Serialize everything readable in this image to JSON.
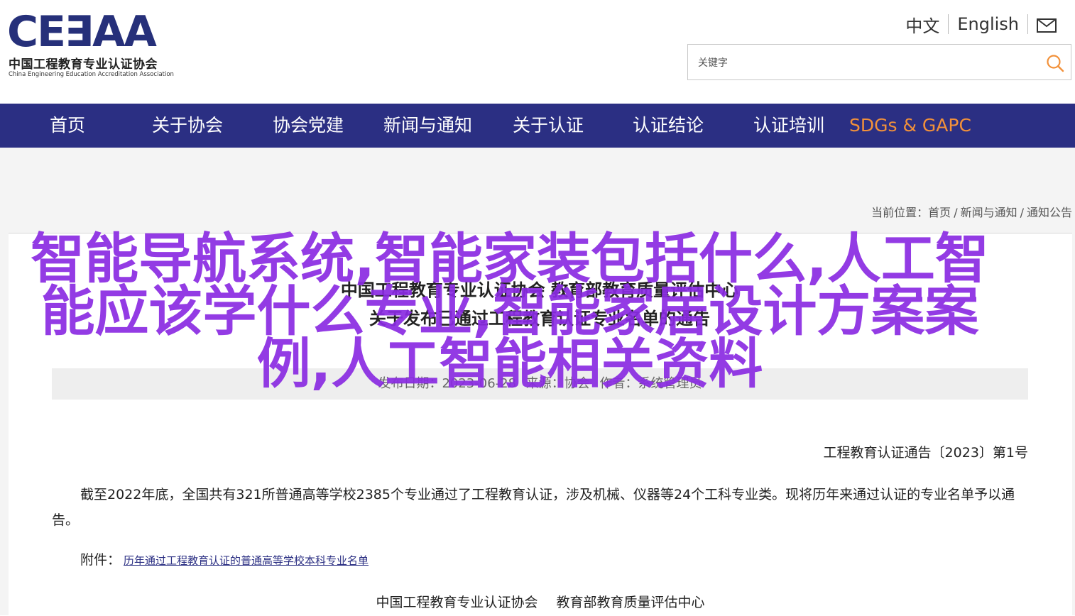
{
  "logo": {
    "mark": "CE∃AA",
    "name_cn": "中国工程教育专业认证协会",
    "name_en": "China Engineering Education Accreditation Association"
  },
  "lang": {
    "cn": "中文",
    "en": "English"
  },
  "search": {
    "placeholder": "关键字"
  },
  "nav": {
    "items": [
      {
        "label": "首页"
      },
      {
        "label": "关于协会"
      },
      {
        "label": "协会党建"
      },
      {
        "label": "新闻与通知"
      },
      {
        "label": "关于认证"
      },
      {
        "label": "认证结论"
      },
      {
        "label": "认证培训"
      },
      {
        "label": "SDGs & GAPC"
      }
    ],
    "accent_color": "#f2913a",
    "bg_color": "#2b2f83"
  },
  "breadcrumb": {
    "prefix": "当前位置：",
    "items": [
      "首页",
      "新闻与通知",
      "通知公告"
    ],
    "sep": "/"
  },
  "article": {
    "title_line1": "中国工程教育专业认证协会 教育部教育质量评估中心",
    "title_line2": "关于发布已通过工程教育认证专业名单的通告",
    "meta": {
      "date": "发布日期：2023-06-28",
      "source": "来源：协会",
      "author": "作者：系统管理员"
    },
    "notice_no": "工程教育认证通告〔2023〕第1号",
    "paragraph": "截至2022年底，全国共有321所普通高等学校2385个专业通过了工程教育认证，涉及机械、仪器等24个工科专业类。现将历年来通过认证的专业名单予以通告。",
    "attachment_label": "附件：",
    "attachment_link": "历年通过工程教育认证的普通高等学校本科专业名单",
    "signatures": [
      "中国工程教育专业认证协会",
      "教育部教育质量评估中心"
    ]
  },
  "overlay": {
    "text": "智能导航系统,智能家装包括什么,人工智能应该学什么专业,智能家居设计方案案例,人工智能相关资料",
    "color": "#8a2be2"
  }
}
